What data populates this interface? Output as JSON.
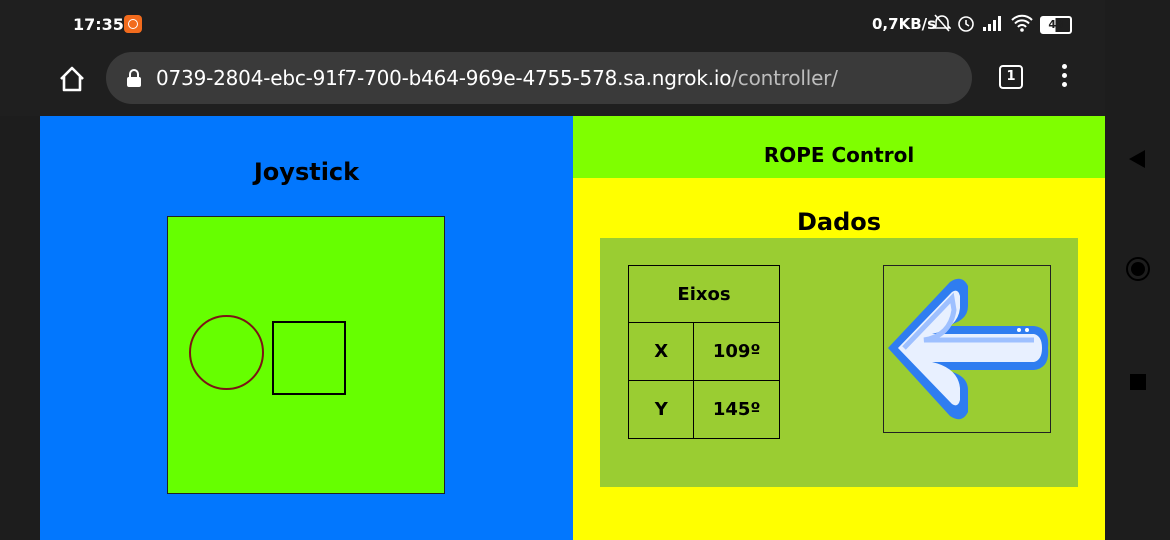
{
  "status_bar": {
    "time": "17:35",
    "network_speed": "0,7KB/s",
    "battery": "48"
  },
  "browser": {
    "url_host": "0739-2804-ebc-91f7-700-b464-969e-4755-578.sa.ngrok.io",
    "url_path": "/controller/",
    "tab_count": "1"
  },
  "page": {
    "joystick_title": "Joystick",
    "header_title": "ROPE Control",
    "data_title": "Dados",
    "axes_table": {
      "header": "Eixos",
      "rows": [
        {
          "axis": "X",
          "value": "109º"
        },
        {
          "axis": "Y",
          "value": "145º"
        }
      ]
    },
    "direction_icon": "arrow-left-icon"
  },
  "colors": {
    "left_panel": "#0277fe",
    "joystick_area": "#66ff00",
    "header_bg": "#7fff00",
    "right_panel": "#ffff00",
    "data_panel": "#9acd32"
  }
}
